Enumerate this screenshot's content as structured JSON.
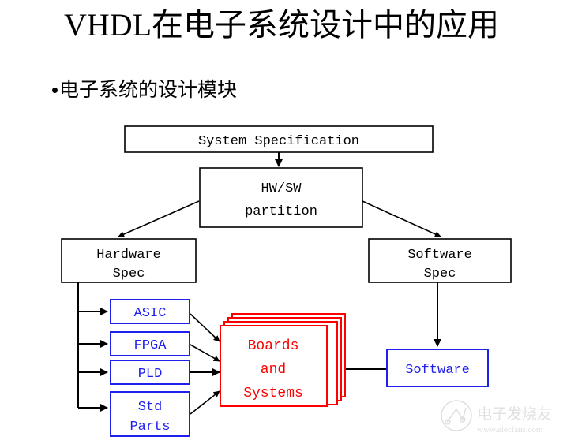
{
  "slide": {
    "title": "VHDL在电子系统设计中的应用",
    "bullet": "电子系统的设计模块"
  },
  "diagram": {
    "name": "electronic-system-design-flow",
    "nodes": {
      "system_spec": "System Specification",
      "hwsw_partition_line1": "HW/SW",
      "hwsw_partition_line2": "partition",
      "hardware_spec_line1": "Hardware",
      "hardware_spec_line2": "Spec",
      "software_spec_line1": "Software",
      "software_spec_line2": "Spec",
      "asic": "ASIC",
      "fpga": "FPGA",
      "pld": "PLD",
      "std_parts_line1": "Std",
      "std_parts_line2": "Parts",
      "boards_line1": "Boards",
      "boards_line2": "and",
      "boards_line3": "Systems",
      "software": "Software"
    },
    "colors": {
      "black": "#000000",
      "blue": "#2020ee",
      "red": "#ff0000",
      "background": "#ffffff"
    }
  },
  "watermark": {
    "brand": "电子发烧友",
    "url": "www.elecfans.com"
  }
}
